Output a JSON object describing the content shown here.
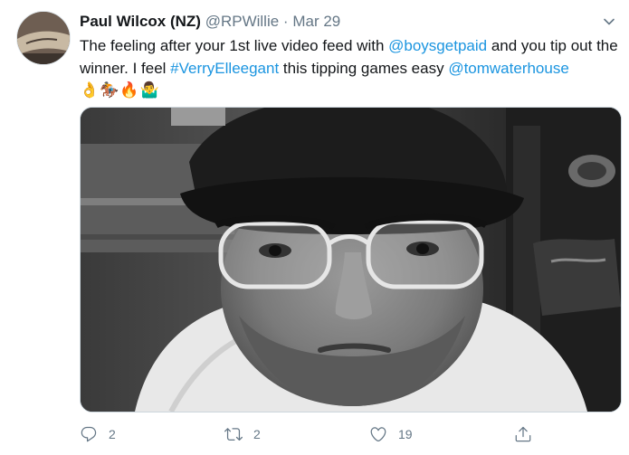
{
  "tweet": {
    "author_name": "Paul Wilcox (NZ)",
    "handle": "@RPWillie",
    "separator": "·",
    "date": "Mar 29",
    "text_1": "The feeling after your 1st live video feed with ",
    "mention_1": "@boysgetpaid",
    "text_2": " and you tip out the winner. I feel ",
    "hashtag": "#VerryElleegant",
    "text_3": " this tipping games easy ",
    "mention_2": "@tomwaterhouse",
    "emojis": "👌🏇🔥🤷‍♂️",
    "actions": {
      "reply_count": "2",
      "retweet_count": "2",
      "like_count": "19"
    }
  },
  "icons": [
    "avatar",
    "chevron-down-icon",
    "reply-icon",
    "retweet-icon",
    "like-icon",
    "share-icon"
  ],
  "colors": {
    "link": "#1b95e0",
    "secondary": "#657786",
    "text": "#14171a"
  }
}
